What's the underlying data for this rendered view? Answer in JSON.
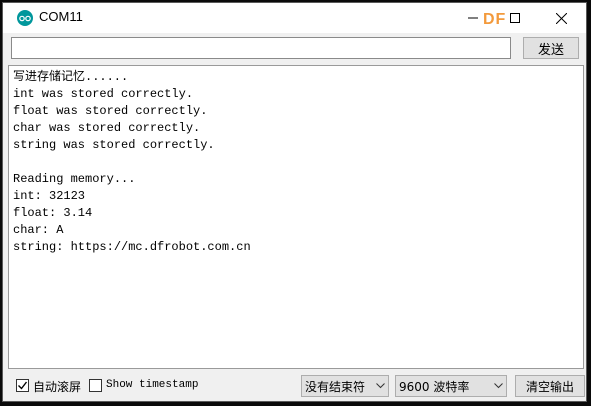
{
  "window": {
    "title": "COM11",
    "watermark": "DF"
  },
  "send": {
    "input_value": "",
    "button_label": "发送"
  },
  "output": {
    "lines": [
      "写进存储记忆......",
      "int was stored correctly.",
      "float was stored correctly.",
      "char was stored correctly.",
      "string was stored correctly.",
      "",
      "Reading memory...",
      "int: 32123",
      "float: 3.14",
      "char: A",
      "string: https://mc.dfrobot.com.cn"
    ]
  },
  "bottom": {
    "autoscroll_label": "自动滚屏",
    "autoscroll_checked": true,
    "timestamp_label": "Show timestamp",
    "timestamp_checked": false,
    "line_ending": "没有结束符",
    "baud_rate": "9600 波特率",
    "clear_label": "清空输出"
  },
  "colors": {
    "app_icon": "#00979c",
    "watermark": "#f39a3c"
  }
}
